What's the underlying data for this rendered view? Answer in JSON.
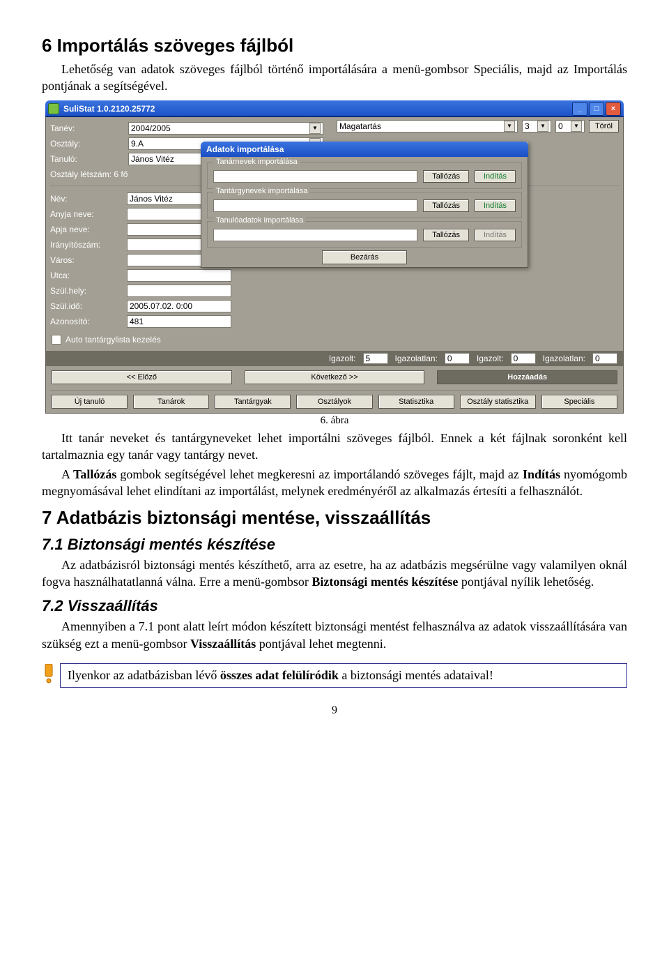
{
  "doc": {
    "h6": "6   Importálás szöveges fájlból",
    "p1": "Lehetőség van adatok szöveges fájlból történő importálására a menü-gombsor Speciális, majd az Importálás pontjának a segítségével.",
    "fig_caption": "6. ábra",
    "p2a": "Itt tanár neveket és tantárgyneveket lehet importálni szöveges fájlból. Ennek a két fájlnak soronként kell tartalmaznia egy tanár vagy tantárgy nevet.",
    "p3": "A Tallózás gombok segítségével lehet megkeresni az importálandó szöveges fájlt, majd az Indítás nyomógomb megnyomásával lehet elindítani az importálást, melynek eredményéről az alkalmazás értesíti a felhasználót.",
    "h7": "7   Adatbázis biztonsági mentése, visszaállítás",
    "h71": "7.1  Biztonsági mentés készítése",
    "p71": "Az adatbázisról biztonsági mentés készíthető, arra az esetre, ha az adatbázis megsérülne vagy valamilyen oknál fogva használhatatlanná válna. Erre a menü-gombsor Biztonsági mentés készítése pontjával nyílik lehetőség.",
    "h72": "7.2  Visszaállítás",
    "p72": "Amennyiben a 7.1 pont alatt leírt módon készített biztonsági mentést felhasználva az adatok visszaállítására van szükség ezt a menü-gombsor Visszaállítás pontjával lehet megtenni.",
    "note": "Ilyenkor az adatbázisban lévő összes adat felülíródik a biztonsági mentés adataival!",
    "note_bold": "összes adat felülíródik",
    "page_num": "9"
  },
  "window": {
    "title": "SuliStat 1.0.2120.25772",
    "top": {
      "tanev_lbl": "Tanév:",
      "tanev_val": "2004/2005",
      "osztaly_lbl": "Osztály:",
      "osztaly_val": "9.A",
      "tanulo_lbl": "Tanuló:",
      "tanulo_val": "János Vitéz",
      "letszam": "Osztály létszám: 6 fő",
      "magatartas": "Magatartás",
      "grade1": "3",
      "grade2": "0",
      "torol": "Töröl"
    },
    "form": {
      "nev_lbl": "Név:",
      "nev_val": "János Vitéz",
      "anyja_lbl": "Anyja neve:",
      "apja_lbl": "Apja neve:",
      "irsz_lbl": "Irányítószám:",
      "varos_lbl": "Város:",
      "utca_lbl": "Utca:",
      "szulhely_lbl": "Szül.hely:",
      "szulido_lbl": "Szül.idő:",
      "szulido_val": "2005.07.02. 0:00",
      "azon_lbl": "Azonosító:",
      "azon_val": "481",
      "auto_chk": "Auto tantárgylista kezelés"
    },
    "strip": {
      "igazolt1_lbl": "Igazolt:",
      "igazolt1_val": "5",
      "igazolatlan1_lbl": "Igazolatlan:",
      "igazolatlan1_val": "0",
      "igazolt2_lbl": "Igazolt:",
      "igazolt2_val": "0",
      "igazolatlan2_lbl": "Igazolatlan:",
      "igazolatlan2_val": "0"
    },
    "nav": {
      "prev": "<< Előző",
      "next": "Következő >>",
      "add": "Hozzáadás"
    },
    "menu": {
      "uj": "Új tanuló",
      "tanarok": "Tanárok",
      "tantargyak": "Tantárgyak",
      "osztalyok": "Osztályok",
      "stat": "Statisztika",
      "osztat": "Osztály statisztika",
      "spec": "Speciális"
    }
  },
  "dialog": {
    "title": "Adatok importálása",
    "g1": "Tanárnevek importálása",
    "g2": "Tantárgynevek importálása",
    "g3": "Tanulóadatok importálása",
    "browse": "Tallózás",
    "start": "Indítás",
    "close": "Bezárás"
  }
}
